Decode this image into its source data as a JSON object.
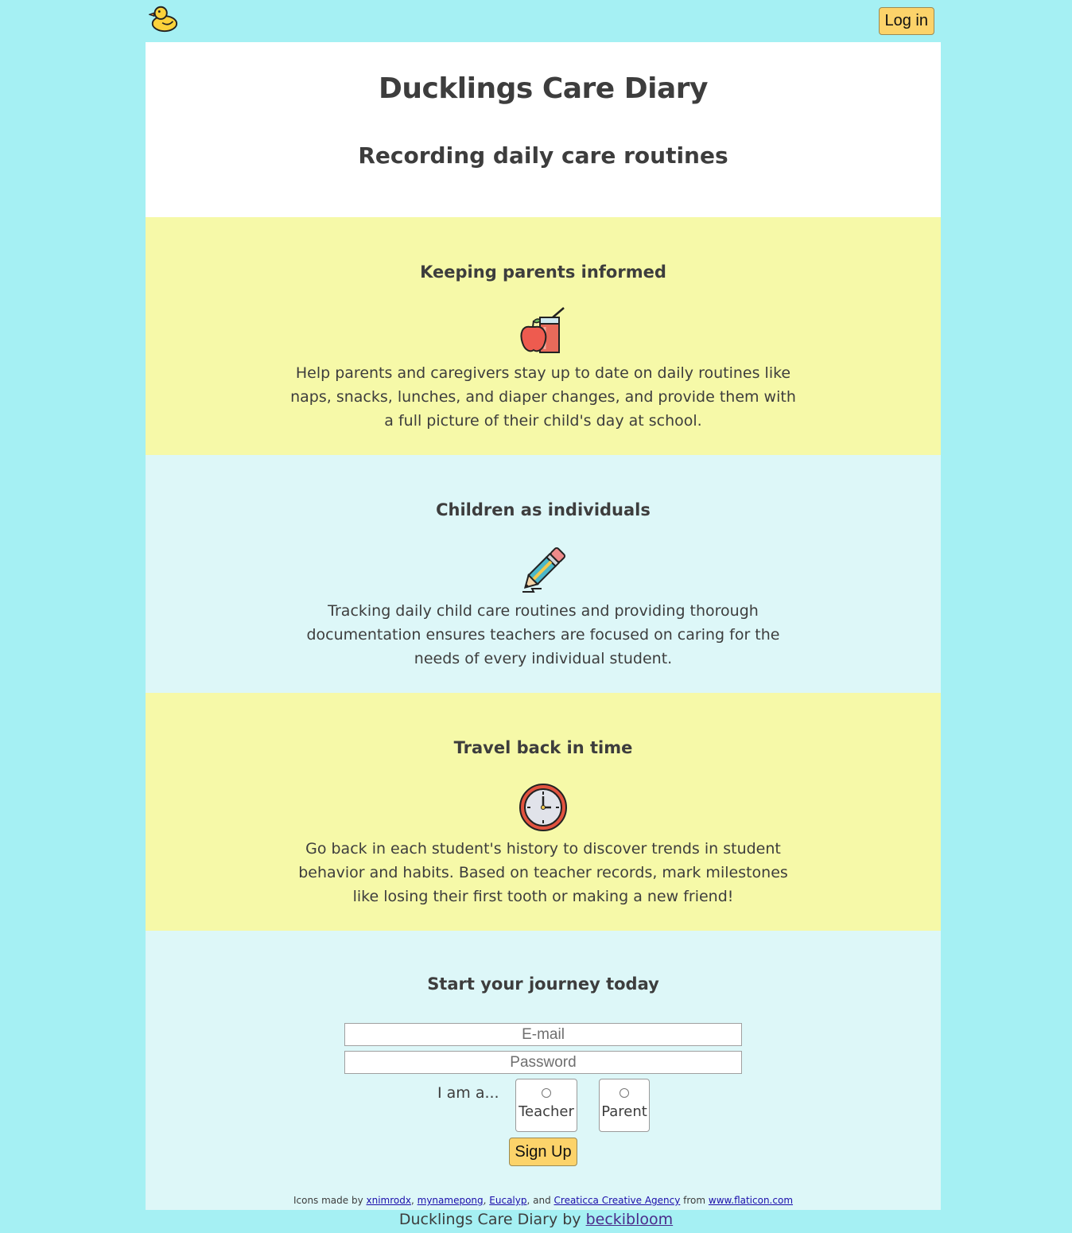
{
  "nav": {
    "logo_alt": "duck",
    "login_label": "Log in"
  },
  "hero": {
    "title": "Ducklings Care Diary",
    "subtitle": "Recording daily care routines"
  },
  "features": [
    {
      "title": "Keeping parents informed",
      "icon": "apple-juice-icon",
      "text": "Help parents and caregivers stay up to date on daily routines like naps, snacks, lunches, and diaper changes, and provide them with a full picture of their child's day at school."
    },
    {
      "title": "Children as individuals",
      "icon": "pencil-icon",
      "text": "Tracking daily child care routines and providing thorough documentation ensures teachers are focused on caring for the needs of every individual student."
    },
    {
      "title": "Travel back in time",
      "icon": "clock-icon",
      "text": "Go back in each student's history to discover trends in student behavior and habits. Based on teacher records, mark milestones like losing their first tooth or making a new friend!"
    }
  ],
  "signup": {
    "title": "Start your journey today",
    "email_placeholder": "E-mail",
    "password_placeholder": "Password",
    "role_label": "I am a...",
    "roles": [
      "Teacher",
      "Parent"
    ],
    "button_label": "Sign Up"
  },
  "credits": {
    "prefix": "Icons made by ",
    "authors": [
      "xnimrodx",
      "mynamepong",
      "Eucalyp",
      "Creaticca Creative Agency"
    ],
    "sep1": ", ",
    "sep2": ", ",
    "sep3": ", and ",
    "from_text": " from ",
    "site": "www.flaticon.com"
  },
  "footer": {
    "text": "Ducklings Care Diary by ",
    "author": "beckibloom"
  },
  "colors": {
    "page_bg": "#a5f0f3",
    "yellow_section": "#f6f9a8",
    "cyan_section": "#ddf7f8",
    "button": "#fcd36a"
  }
}
